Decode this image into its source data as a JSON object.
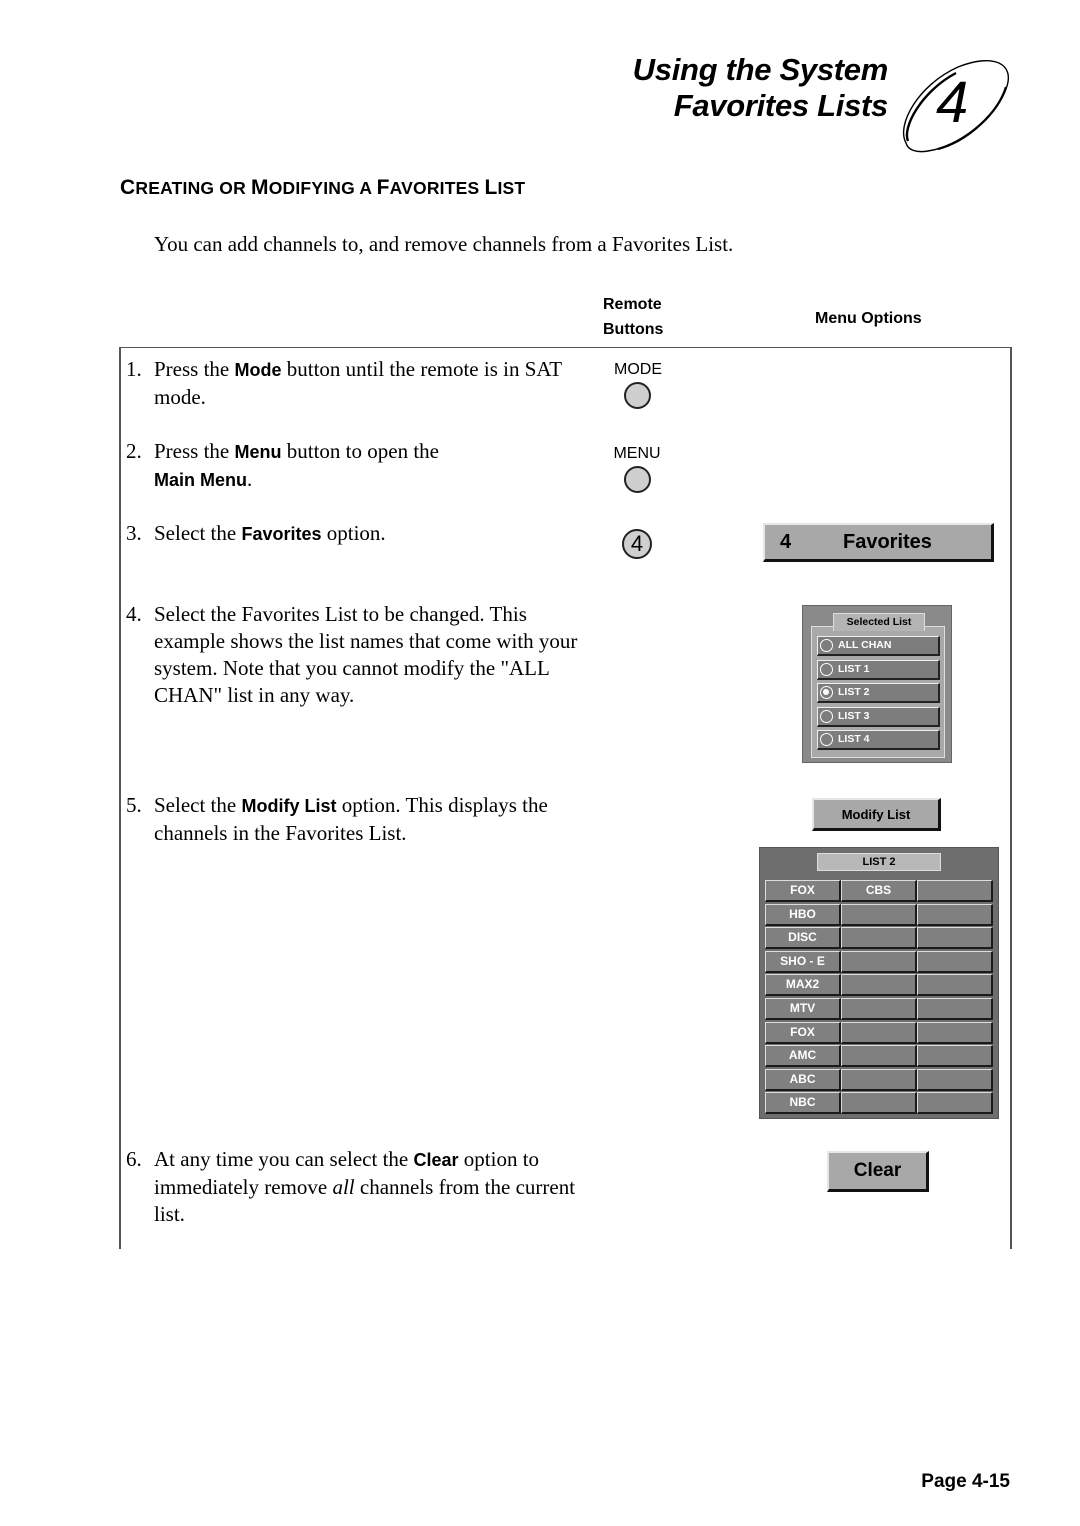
{
  "header": {
    "title_line1": "Using the System",
    "title_line2": "Favorites Lists",
    "chapter_number": "4"
  },
  "section": {
    "heading_parts": [
      {
        "big": "C",
        "small": "REATING OR "
      },
      {
        "big": "M",
        "small": "ODIFYING A "
      },
      {
        "big": "F",
        "small": "AVORITES "
      },
      {
        "big": "L",
        "small": "IST"
      }
    ],
    "intro": "You can add channels to, and remove channels from a Favorites List."
  },
  "columns": {
    "remote_buttons_line1": "Remote",
    "remote_buttons_line2": "Buttons",
    "menu_options": "Menu Options"
  },
  "steps": [
    {
      "num": "1.",
      "pre": "Press the ",
      "bold": "Mode",
      "post": " button until the remote is in SAT mode."
    },
    {
      "num": "2.",
      "pre": "Press the ",
      "bold": "Menu",
      "post": " button to open the ",
      "bold2": "Main Menu",
      "post2": "."
    },
    {
      "num": "3.",
      "pre": "Select the ",
      "bold": "Favorites",
      "post": " option."
    },
    {
      "num": "4.",
      "pre": "Select the Favorites List to be changed. This example shows the list names that come with your system.  Note that you cannot modify the \"ALL CHAN\" list in any way."
    },
    {
      "num": "5.",
      "pre": "Select the ",
      "bold": "Modify List",
      "post": " option.  This displays the channels in the Favorites List."
    },
    {
      "num": "6.",
      "pre": "At any time you can select the ",
      "bold": "Clear",
      "post": " option to immediately remove ",
      "ital": "all",
      "post2": " channels from the current list."
    }
  ],
  "remote": {
    "mode_label": "MODE",
    "menu_label": "MENU",
    "number_button": "4"
  },
  "menu": {
    "favorites_number": "4",
    "favorites_label": "Favorites",
    "selected_list_title": "Selected List",
    "list_options": [
      {
        "label": "ALL CHAN",
        "selected": false
      },
      {
        "label": "LIST 1",
        "selected": false
      },
      {
        "label": "LIST 2",
        "selected": true
      },
      {
        "label": "LIST 3",
        "selected": false
      },
      {
        "label": "LIST 4",
        "selected": false
      }
    ],
    "modify_list_label": "Modify List",
    "channel_list_title": "LIST 2",
    "channel_grid": [
      [
        "FOX",
        "CBS",
        ""
      ],
      [
        "HBO",
        "",
        ""
      ],
      [
        "DISC",
        "",
        ""
      ],
      [
        "SHO - E",
        "",
        ""
      ],
      [
        "MAX2",
        "",
        ""
      ],
      [
        "MTV",
        "",
        ""
      ],
      [
        "FOX",
        "",
        ""
      ],
      [
        "AMC",
        "",
        ""
      ],
      [
        "ABC",
        "",
        ""
      ],
      [
        "NBC",
        "",
        ""
      ]
    ],
    "clear_label": "Clear"
  },
  "footer": {
    "page_label": "Page 4-15"
  }
}
